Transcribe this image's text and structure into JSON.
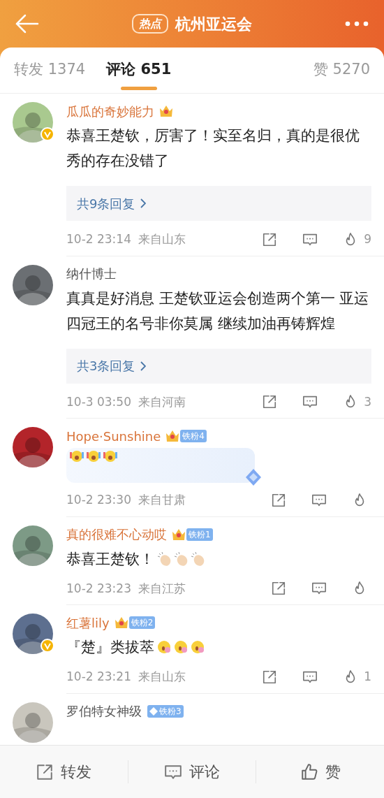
{
  "header": {
    "badge": "热点",
    "title": "杭州亚运会"
  },
  "tabs": [
    {
      "label": "转发 1374",
      "selected": false
    },
    {
      "label": "评论 651",
      "selected": true
    },
    {
      "label": "赞 5270",
      "selected": false
    }
  ],
  "comments": [
    {
      "name": "瓜瓜的奇妙能力",
      "vip": true,
      "crown": true,
      "verified": true,
      "kind": "plain",
      "text": "恭喜王楚钦，厉害了！实至名归，真的是很优秀的存在没错了",
      "replies": "共9条回复",
      "time": "10-2 23:14",
      "location": "来自山东",
      "likes": "9"
    },
    {
      "name": "纳什博士",
      "vip": false,
      "kind": "plain",
      "text": "真真是好消息 王楚钦亚运会创造两个第一 亚运四冠王的名号非你莫属  继续加油再铸辉煌",
      "replies": "共3条回复",
      "time": "10-3 03:50",
      "location": "来自河南",
      "likes": "3"
    },
    {
      "name": "Hope·Sunshine",
      "vip": true,
      "crown": true,
      "fan_badge": "铁粉4",
      "decorated": true,
      "kind": "cheering",
      "time": "10-2 23:30",
      "location": "来自甘肃"
    },
    {
      "name": "真的很难不心动哎",
      "vip": true,
      "crown": true,
      "fan_badge": "铁粉1",
      "kind": "clapping",
      "text": "恭喜王楚钦！",
      "time": "10-2 23:23",
      "location": "来自江苏"
    },
    {
      "name": "红薯lily",
      "vip": true,
      "crown": true,
      "fan_badge": "铁粉2",
      "verified": true,
      "kind": "blooming",
      "text": "『楚』类拔萃",
      "time": "10-2 23:21",
      "location": "来自山东",
      "likes": "1"
    },
    {
      "name": "罗伯特女神级",
      "vip": false,
      "diamond": true,
      "fan_badge": "铁粉3",
      "kind": "plain"
    }
  ],
  "bottom_bar": [
    {
      "kind": "share",
      "label": "转发"
    },
    {
      "kind": "comment",
      "label": "评论"
    },
    {
      "kind": "like",
      "label": "赞"
    }
  ]
}
